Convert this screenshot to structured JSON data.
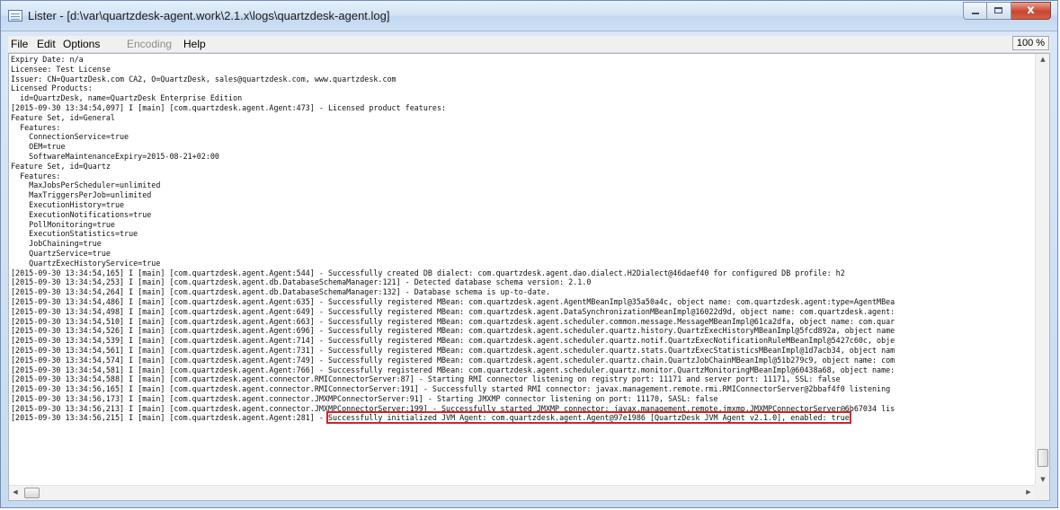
{
  "window": {
    "title": "Lister - [d:\\var\\quartzdesk-agent.work\\2.1.x\\logs\\quartzdesk-agent.log]",
    "close_glyph": "x"
  },
  "menu": {
    "file": "File",
    "edit": "Edit",
    "options": "Options",
    "encoding": "Encoding",
    "help": "Help",
    "zoom": "100 %"
  },
  "log_lines": [
    "Expiry Date: n/a",
    "Licensee: Test License",
    "Issuer: CN=QuartzDesk.com CA2, O=QuartzDesk, sales@quartzdesk.com, www.quartzdesk.com",
    "Licensed Products:",
    "  id=QuartzDesk, name=QuartzDesk Enterprise Edition",
    "[2015-09-30 13:34:54,097] I [main] [com.quartzdesk.agent.Agent:473] - Licensed product features:",
    "Feature Set, id=General",
    "  Features:",
    "    ConnectionService=true",
    "    OEM=true",
    "    SoftwareMaintenanceExpiry=2015-08-21+02:00",
    "Feature Set, id=Quartz",
    "  Features:",
    "    MaxJobsPerScheduler=unlimited",
    "    MaxTriggersPerJob=unlimited",
    "    ExecutionHistory=true",
    "    ExecutionNotifications=true",
    "    PollMonitoring=true",
    "    ExecutionStatistics=true",
    "    JobChaining=true",
    "    QuartzService=true",
    "    QuartzExecHistoryService=true",
    "[2015-09-30 13:34:54,165] I [main] [com.quartzdesk.agent.Agent:544] - Successfully created DB dialect: com.quartzdesk.agent.dao.dialect.H2Dialect@46daef40 for configured DB profile: h2",
    "[2015-09-30 13:34:54,253] I [main] [com.quartzdesk.agent.db.DatabaseSchemaManager:121] - Detected database schema version: 2.1.0",
    "[2015-09-30 13:34:54,264] I [main] [com.quartzdesk.agent.db.DatabaseSchemaManager:132] - Database schema is up-to-date.",
    "[2015-09-30 13:34:54,486] I [main] [com.quartzdesk.agent.Agent:635] - Successfully registered MBean: com.quartzdesk.agent.AgentMBeanImpl@35a50a4c, object name: com.quartzdesk.agent:type=AgentMBea",
    "[2015-09-30 13:34:54,498] I [main] [com.quartzdesk.agent.Agent:649] - Successfully registered MBean: com.quartzdesk.agent.DataSynchronizationMBeanImpl@16022d9d, object name: com.quartzdesk.agent:",
    "[2015-09-30 13:34:54,510] I [main] [com.quartzdesk.agent.Agent:663] - Successfully registered MBean: com.quartzdesk.agent.scheduler.common.message.MessageMBeanImpl@61ca2dfa, object name: com.quar",
    "[2015-09-30 13:34:54,526] I [main] [com.quartzdesk.agent.Agent:696] - Successfully registered MBean: com.quartzdesk.agent.scheduler.quartz.history.QuartzExecHistoryMBeanImpl@5fcd892a, object name",
    "[2015-09-30 13:34:54,539] I [main] [com.quartzdesk.agent.Agent:714] - Successfully registered MBean: com.quartzdesk.agent.scheduler.quartz.notif.QuartzExecNotificationRuleMBeanImpl@5427c60c, obje",
    "[2015-09-30 13:34:54,561] I [main] [com.quartzdesk.agent.Agent:731] - Successfully registered MBean: com.quartzdesk.agent.scheduler.quartz.stats.QuartzExecStatisticsMBeanImpl@1d7acb34, object nam",
    "[2015-09-30 13:34:54,574] I [main] [com.quartzdesk.agent.Agent:749] - Successfully registered MBean: com.quartzdesk.agent.scheduler.quartz.chain.QuartzJobChainMBeanImpl@51b279c9, object name: com",
    "[2015-09-30 13:34:54,581] I [main] [com.quartzdesk.agent.Agent:766] - Successfully registered MBean: com.quartzdesk.agent.scheduler.quartz.monitor.QuartzMonitoringMBeanImpl@60438a68, object name:",
    "[2015-09-30 13:34:54,588] I [main] [com.quartzdesk.agent.connector.RMIConnectorServer:87] - Starting RMI connector listening on registry port: 11171 and server port: 11171, SSL: false",
    "[2015-09-30 13:34:56,165] I [main] [com.quartzdesk.agent.connector.RMIConnectorServer:191] - Successfully started RMI connector: javax.management.remote.rmi.RMIConnectorServer@2bbaf4f0 listening",
    "[2015-09-30 13:34:56,173] I [main] [com.quartzdesk.agent.connector.JMXMPConnectorServer:91] - Starting JMXMP connector listening on port: 11170, SASL: false",
    "[2015-09-30 13:34:56,213] I [main] [com.quartzdesk.agent.connector.JMXMPConnectorServer:199] - Successfully started JMXMP connector: javax.management.remote.jmxmp.JMXMPConnectorServer@6b67034 lis"
  ],
  "last_line": {
    "prefix": "[2015-09-30 13:34:56,215] I [main] [com.quartzdesk.agent.Agent:281] - ",
    "highlighted": "Successfully initialized JVM Agent: com.quartzdesk.agent.Agent@97e1986 [QuartzDesk JVM Agent v2.1.0], enabled: true"
  },
  "icons": {
    "app": "document-list-icon",
    "minimize": "minimize-icon",
    "maximize": "maximize-icon",
    "close": "close-icon",
    "scroll_up": "arrow-up-icon",
    "scroll_down": "arrow-down-icon",
    "scroll_left": "arrow-left-icon",
    "scroll_right": "arrow-right-icon"
  },
  "colors": {
    "highlight_border": "#d42525",
    "title_bar": "#c7daf0",
    "close_button": "#c9452f"
  }
}
